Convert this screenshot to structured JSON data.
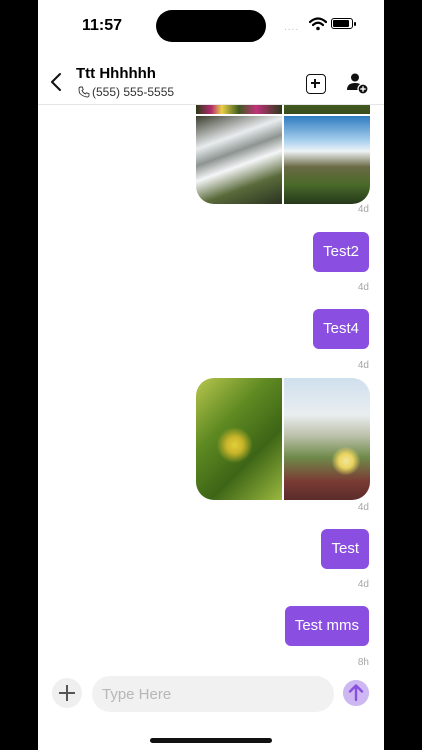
{
  "status_bar": {
    "time": "11:57",
    "signal": "...."
  },
  "header": {
    "contact_name": "Ttt Hhhhhh",
    "phone": "(555) 555-5555",
    "back_icon": "chevron-left-icon",
    "add_icon": "plus-square-icon",
    "add_contact_icon": "person-add-icon"
  },
  "messages": [
    {
      "type": "mms",
      "images": [
        "flowers",
        "grass",
        "waterfall-stream",
        "waterfall-cliff"
      ],
      "time": "4d"
    },
    {
      "type": "text",
      "text": "Test2",
      "time": "4d"
    },
    {
      "type": "text",
      "text": "Test4",
      "time": "4d"
    },
    {
      "type": "mms",
      "images": [
        "green-leaves",
        "coastal-succulents"
      ],
      "time": "4d"
    },
    {
      "type": "text",
      "text": "Test",
      "time": "4d"
    },
    {
      "type": "text",
      "text": "Test mms",
      "time": "8h"
    }
  ],
  "composer": {
    "placeholder": "Type Here",
    "value": "",
    "attach_icon": "plus-icon",
    "send_icon": "arrow-up-icon"
  },
  "colors": {
    "bubble": "#8a4fe0",
    "send_button": "#cdb8f2"
  }
}
